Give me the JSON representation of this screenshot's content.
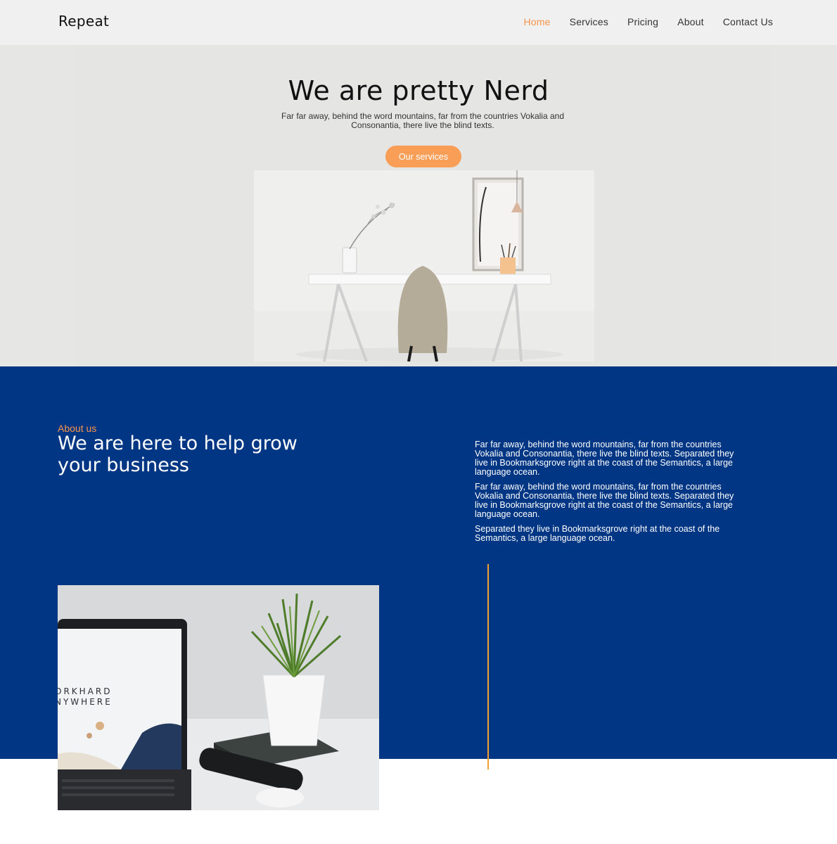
{
  "nav": {
    "brand": "Repeat",
    "items": [
      {
        "label": "Home",
        "active": true
      },
      {
        "label": "Services",
        "active": false
      },
      {
        "label": "Pricing",
        "active": false
      },
      {
        "label": "About",
        "active": false
      },
      {
        "label": "Contact Us",
        "active": false
      }
    ]
  },
  "hero": {
    "title": "We are pretty Nerd",
    "subtitle": "Far far away, behind the word mountains, far from the countries Vokalia and Consonantia, there live the blind texts.",
    "button_label": "Our services",
    "image": "desk-chair-lamp-photo"
  },
  "about": {
    "kicker": "About us",
    "heading": "We are here to help grow your business",
    "paragraphs": [
      "Far far away, behind the word mountains, far from the countries Vokalia and Consonantia, there live the blind texts. Separated they live in Bookmarksgrove right at the coast of the Semantics, a large language ocean.",
      "Far far away, behind the word mountains, far from the countries Vokalia and Consonantia, there live the blind texts. Separated they live in Bookmarksgrove right at the coast of the Semantics, a large language ocean.",
      "Separated they live in Bookmarksgrove right at the coast of the Semantics, a large language ocean."
    ],
    "photo": {
      "screen_line1": "ORKHARD",
      "screen_line2": "NYWHERE"
    }
  },
  "colors": {
    "accent": "#f7944b",
    "button": "#f99e56",
    "about_bg": "#013684",
    "divider": "#f2a02e"
  }
}
